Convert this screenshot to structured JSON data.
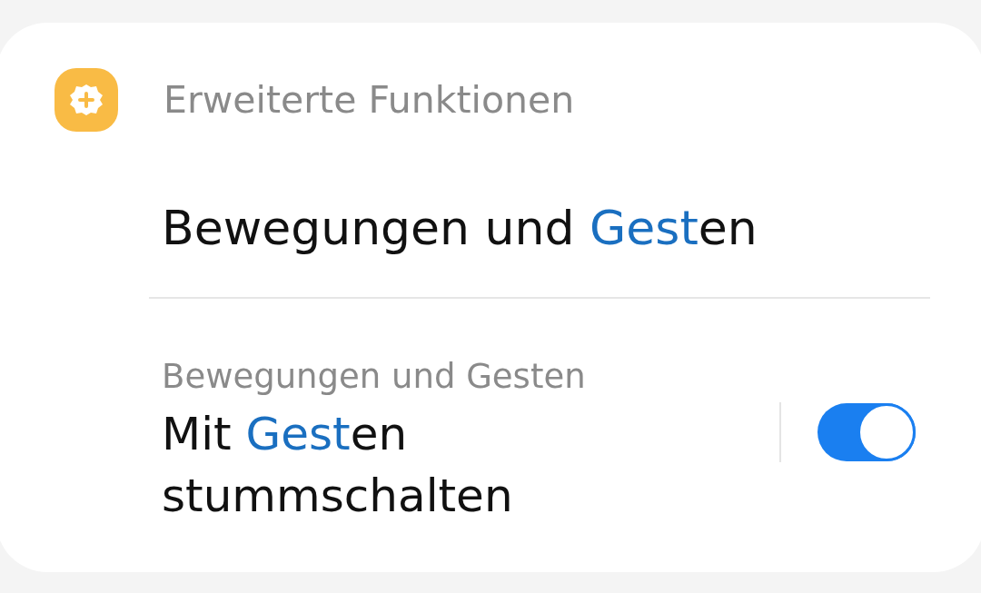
{
  "section": {
    "title": "Erweiterte Funktionen"
  },
  "result_title": [
    {
      "text": "Bewegungen und ",
      "highlighted": false
    },
    {
      "text": "Gest",
      "highlighted": true
    },
    {
      "text": "en",
      "highlighted": false
    }
  ],
  "setting": {
    "path": "Bewegungen und Gesten",
    "label": [
      {
        "text": "Mit ",
        "highlighted": false
      },
      {
        "text": "Gest",
        "highlighted": true
      },
      {
        "text": "en stummschalten",
        "highlighted": false
      }
    ],
    "on": true
  }
}
